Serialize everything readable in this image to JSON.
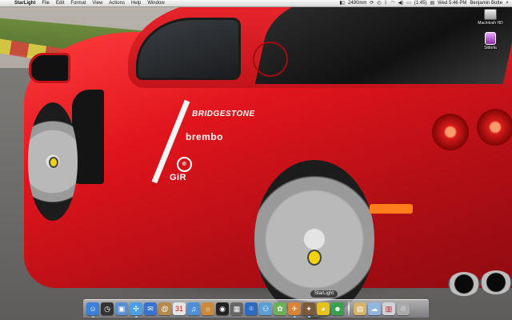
{
  "menubar": {
    "apple_symbol": "",
    "app_name": "StarLight",
    "menus": [
      "File",
      "Edit",
      "Format",
      "View",
      "Actions",
      "Help",
      "Window"
    ],
    "status": {
      "memory": "2490mm",
      "battery": "(1:45)",
      "clock": "Wed 5:46 PM",
      "user": "Benjamin Botte",
      "spotlight_symbol": "⌕"
    }
  },
  "desktop_icons": [
    {
      "label": "Macintosh HD",
      "icon": "hard-drive-icon"
    },
    {
      "label": "Sidorla",
      "icon": "ipod-icon"
    }
  ],
  "wallpaper": {
    "decals": {
      "bridgestone": "BRIDGESTONE",
      "brembo": "brembo",
      "gr": "GiR",
      "logo": "◎"
    }
  },
  "dock": {
    "tooltip": "StarLight",
    "items": [
      {
        "name": "finder",
        "glyph": "☺",
        "color": "#3c7fd9"
      },
      {
        "name": "dashboard",
        "glyph": "◷",
        "color": "#333333"
      },
      {
        "name": "preview",
        "glyph": "▣",
        "color": "#5b8fd1"
      },
      {
        "name": "safari",
        "glyph": "✣",
        "color": "#4aa0e8"
      },
      {
        "name": "ichat",
        "glyph": "✉",
        "color": "#3a72d0"
      },
      {
        "name": "address-book",
        "glyph": "@",
        "color": "#b58a4a"
      },
      {
        "name": "ical",
        "glyph": "31",
        "color": "#e5e5e5"
      },
      {
        "name": "itunes",
        "glyph": "♫",
        "color": "#4f8fd8"
      },
      {
        "name": "iphoto",
        "glyph": "☼",
        "color": "#c98b3d"
      },
      {
        "name": "dvd-player",
        "glyph": "◉",
        "color": "#222222"
      },
      {
        "name": "photo-booth",
        "glyph": "▦",
        "color": "#666666"
      },
      {
        "name": "image-capture",
        "glyph": "⌾",
        "color": "#2b6cc2"
      },
      {
        "name": "network",
        "glyph": "⚇",
        "color": "#5a9fd6"
      },
      {
        "name": "system-preferences",
        "glyph": "✿",
        "color": "#6cb15a"
      },
      {
        "name": "mail",
        "glyph": "✈",
        "color": "#d9823a"
      },
      {
        "name": "starlight",
        "glyph": "✦",
        "color": "#7a5c3a"
      },
      {
        "name": "adium",
        "glyph": "◕",
        "color": "#e6c21c"
      },
      {
        "name": "ichat-contacts",
        "glyph": "☻",
        "color": "#3aa24f"
      },
      {
        "name": "documents-folder",
        "glyph": "▤",
        "color": "#d6b26a"
      },
      {
        "name": "applications-folder",
        "glyph": "☁",
        "color": "#8fb6e0"
      },
      {
        "name": "downloads-stack",
        "glyph": "▥",
        "color": "#cfd3d8"
      },
      {
        "name": "trash",
        "glyph": "♲",
        "color": "#aaaaaa"
      }
    ]
  }
}
